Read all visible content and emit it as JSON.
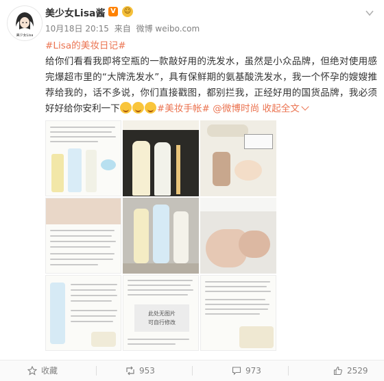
{
  "user": {
    "name": "美少女Lisa酱",
    "avatar_caption": "美少女Lisa"
  },
  "meta": {
    "date": "10月18日 20:15",
    "source_prefix": "来自",
    "source": "微博 weibo.com"
  },
  "post": {
    "topic_tag": "#Lisa的美妆日记#",
    "body": "给你们看看我即将空瓶的一款敲好用的洗发水，虽然是小众品牌，但绝对使用感完爆超市里的“大牌洗发水”，具有保鲜期的氨基酸洗发水，我一个怀孕的嫂嫂推荐给我的，话不多说，你们直接戳图，都别拦我，正经好用的国货品牌，我必须好好给你安利一下",
    "tag2": "#美妆手帐#",
    "mention": "@微博时尚",
    "expand_label": "收起全文"
  },
  "images": {
    "placeholder_line1": "此处无图片",
    "placeholder_line2": "可自行修改"
  },
  "actions": {
    "favorite_label": "收藏",
    "repost_count": "953",
    "comment_count": "973",
    "like_count": "2529"
  },
  "colors": {
    "link": "#eb7350",
    "vip": "#ff8200"
  }
}
